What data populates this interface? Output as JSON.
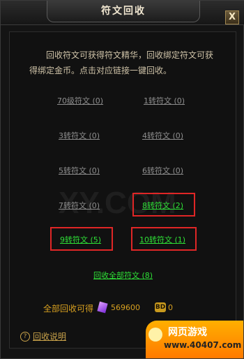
{
  "title": "符文回收",
  "close_label": "X",
  "intro": "回收符文可获得符文精华，回收绑定符文可获得绑定金币。点击对应链接一键回收。",
  "rune_links": [
    {
      "label": "70级符文 (0)",
      "active": false
    },
    {
      "label": "1转符文 (0)",
      "active": false
    },
    {
      "label": "3转符文 (0)",
      "active": false
    },
    {
      "label": "4转符文 (0)",
      "active": false
    },
    {
      "label": "5转符文 (0)",
      "active": false
    },
    {
      "label": "6转符文 (0)",
      "active": false
    },
    {
      "label": "7转符文 (0)",
      "active": false
    },
    {
      "label": "8转符文 (2)",
      "active": true
    },
    {
      "label": "9转符文 (5)",
      "active": true
    },
    {
      "label": "10转符文 (1)",
      "active": true
    }
  ],
  "recycle_all": "回收全部符文 (8)",
  "total": {
    "label": "全部回收可得",
    "essence": "569600",
    "bind_gold": "0"
  },
  "help_label": "回收说明",
  "watermark": "XY.COM",
  "corner_logo": {
    "line1": "网页游戏",
    "line2": "www.40407.com"
  }
}
